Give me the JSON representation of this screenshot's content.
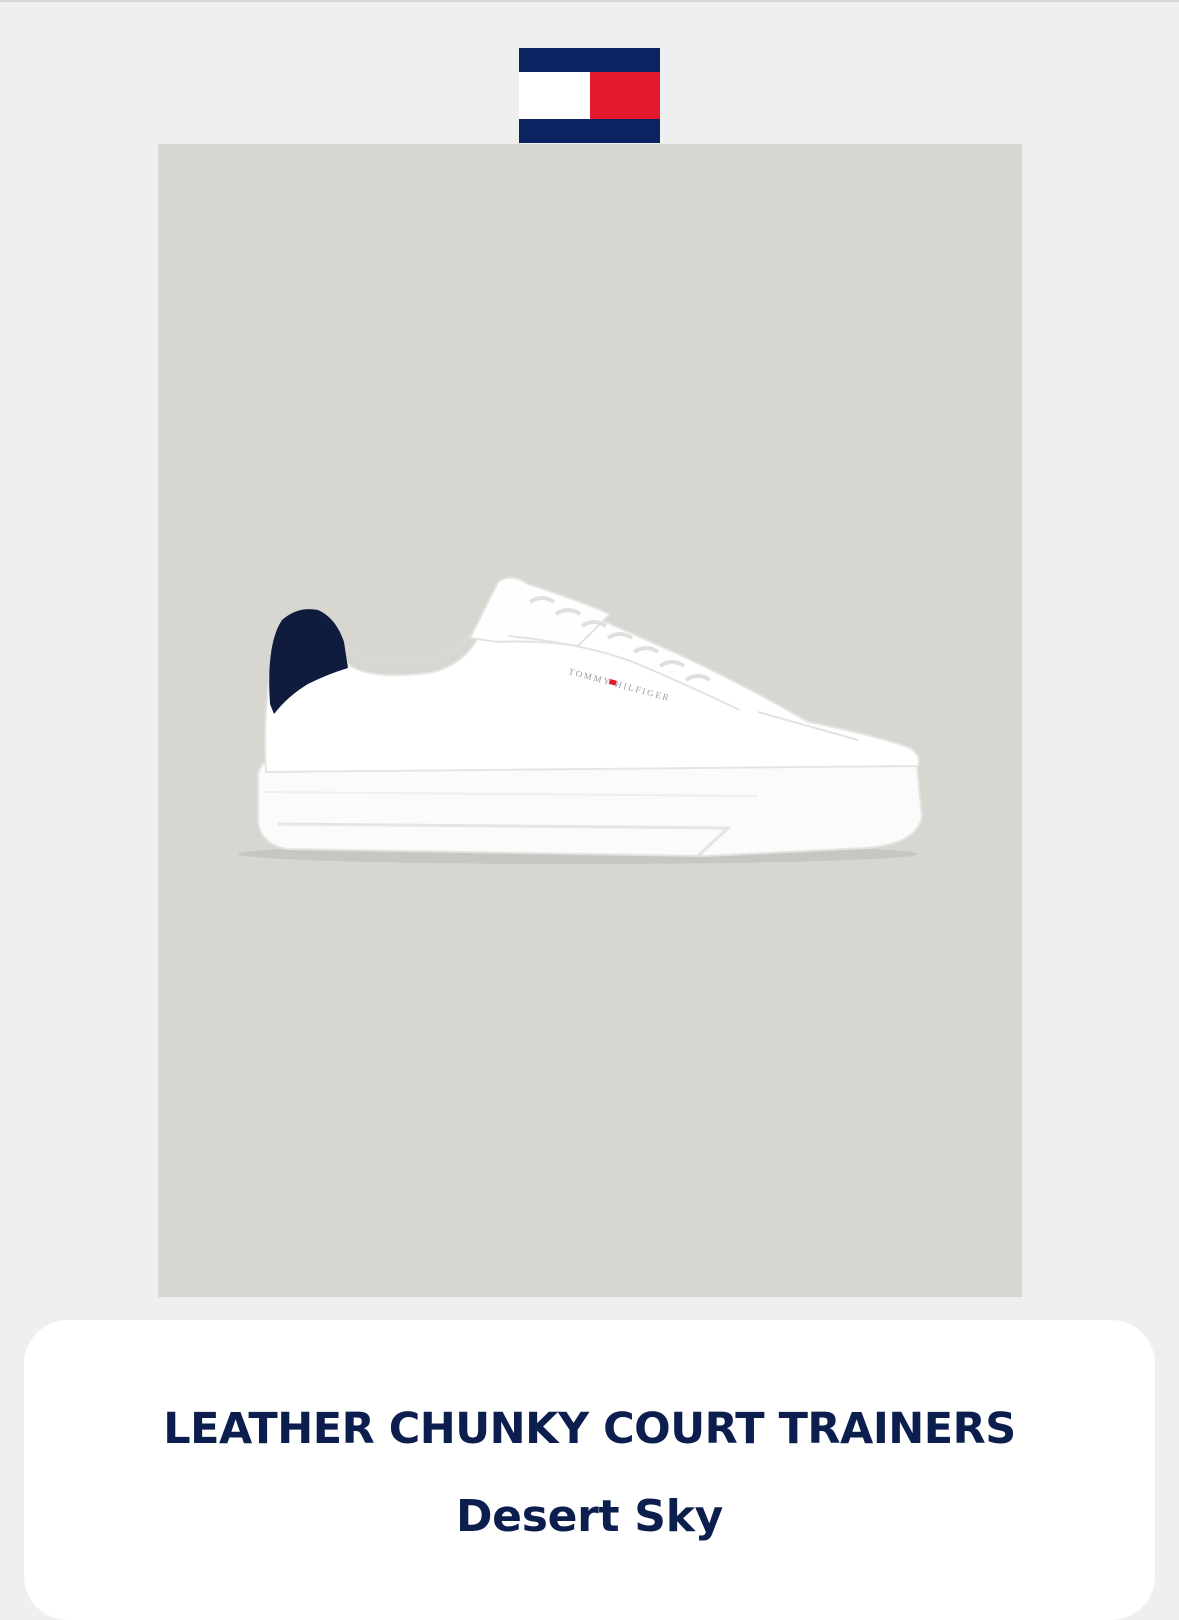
{
  "brand": {
    "logo_icon": "tommy-hilfiger-flag-icon",
    "colors": {
      "navy": "#0b2461",
      "red": "#e3192f",
      "white": "#ffffff"
    }
  },
  "product": {
    "image_icon": "white-sneaker-image",
    "image_background": "#d8d6d1",
    "shoe_print": "TOMMY HILFIGER",
    "title": "LEATHER CHUNKY COURT TRAINERS",
    "color_name": "Desert Sky"
  },
  "theme": {
    "page_background": "#efefef",
    "text_color": "#0b1e4d"
  }
}
